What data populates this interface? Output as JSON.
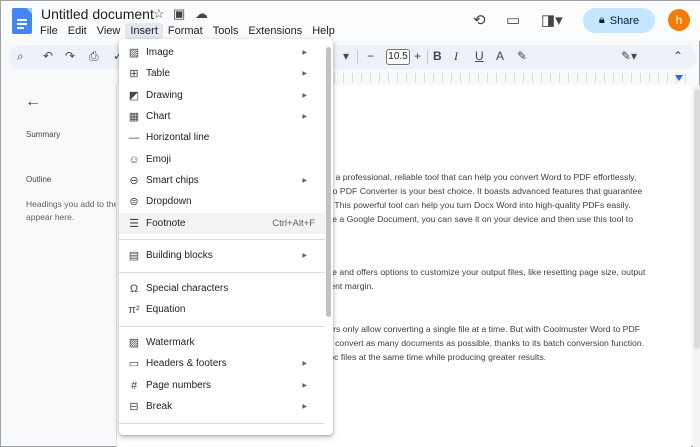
{
  "app": {
    "title": "Untitled document"
  },
  "menubar": {
    "items": [
      "File",
      "Edit",
      "View",
      "Insert",
      "Format",
      "Tools",
      "Extensions",
      "Help"
    ],
    "active": "Insert"
  },
  "header": {
    "share_label": "Share",
    "avatar_letter": "h"
  },
  "toolbar": {
    "font_size": "10.5"
  },
  "sidebar": {
    "summary_label": "Summary",
    "outline_label": "Outline",
    "outline_hint_line1": "Headings you add to the",
    "outline_hint_line2": "appear here."
  },
  "document": {
    "p1": [
      "for a professional, reliable tool that can help you convert Word to PDF effortlessly,",
      "d to PDF Converter is your best choice. It boasts advanced features that guarantee",
      "ts. This powerful tool can help you turn Docx Word into high-quality PDFs easily.",
      "ave a Google Document, you can save it on your device and then use this tool to"
    ],
    "p2": [
      "use and offers options to customize your output files, like resetting page size, output",
      "ment margin."
    ],
    "p3": [
      "rters only allow converting a single file at a time. But with Coolmuster Word to PDF",
      "an convert as many documents as possible, thanks to its batch conversion function.",
      "Doc files at the same time while producing greater results."
    ]
  },
  "insert_menu": {
    "items": [
      {
        "label": "Image",
        "icon": "image-icon",
        "submenu": true
      },
      {
        "label": "Table",
        "icon": "table-icon",
        "submenu": true
      },
      {
        "label": "Drawing",
        "icon": "drawing-icon",
        "submenu": true
      },
      {
        "label": "Chart",
        "icon": "chart-icon",
        "submenu": true
      },
      {
        "label": "Horizontal line",
        "icon": "horizontal-line-icon",
        "submenu": false
      },
      {
        "label": "Emoji",
        "icon": "emoji-icon",
        "submenu": false
      },
      {
        "label": "Smart chips",
        "icon": "smart-chips-icon",
        "submenu": true
      },
      {
        "label": "Dropdown",
        "icon": "dropdown-icon",
        "submenu": false
      },
      {
        "label": "Footnote",
        "icon": "footnote-icon",
        "submenu": false,
        "shortcut": "Ctrl+Alt+F",
        "highlighted": true
      },
      {
        "label": "Building blocks",
        "icon": "building-blocks-icon",
        "submenu": true
      },
      {
        "label": "Special characters",
        "icon": "omega-icon",
        "submenu": false
      },
      {
        "label": "Equation",
        "icon": "pi-icon",
        "submenu": false
      },
      {
        "label": "Watermark",
        "icon": "watermark-icon",
        "submenu": false
      },
      {
        "label": "Headers & footers",
        "icon": "headers-footers-icon",
        "submenu": true
      },
      {
        "label": "Page numbers",
        "icon": "hash-icon",
        "submenu": true
      },
      {
        "label": "Break",
        "icon": "break-icon",
        "submenu": true
      }
    ]
  },
  "colors": {
    "accent": "#1a73e8",
    "share_bg": "#c2e7ff",
    "avatar_bg": "#f57c00",
    "docs_blue": "#4285f4"
  }
}
